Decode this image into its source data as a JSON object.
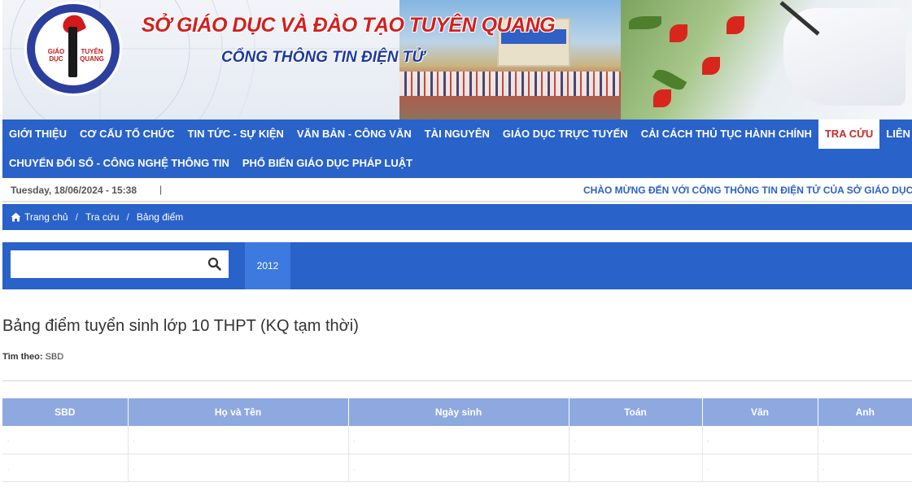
{
  "header": {
    "logo_text_left": "GIÁO DỤC",
    "logo_text_right": "TUYÊN QUANG",
    "title": "SỞ GIÁO DỤC VÀ ĐÀO TẠO TUYÊN QUANG",
    "subtitle": "CỔNG THÔNG TIN ĐIỆN TỬ"
  },
  "menu": {
    "row1": [
      "GIỚI THIỆU",
      "CƠ CẤU TỔ CHỨC",
      "TIN TỨC - SỰ KIỆN",
      "VĂN BẢN - CÔNG VĂN",
      "TÀI NGUYÊN",
      "GIÁO DỤC TRỰC TUYẾN",
      "CẢI CÁCH THỦ TỤC HÀNH CHÍNH",
      "TRA CỨU",
      "LIÊN HỆ"
    ],
    "row2": [
      "CHUYỂN ĐỔI SỐ - CÔNG NGHỆ THÔNG TIN",
      "PHỔ BIẾN GIÁO DỤC PHÁP LUẬT"
    ],
    "active": "TRA CỨU"
  },
  "datebar": {
    "datetime": "Tuesday, 18/06/2024 - 15:38",
    "separator": "|",
    "marquee": "CHÀO MỪNG ĐẾN VỚI CỔNG THÔNG TIN ĐIỆN TỬ CỦA SỞ GIÁO DỤC"
  },
  "breadcrumb": {
    "home": "Trang chủ",
    "items": [
      "Tra cứu",
      "Bảng điểm"
    ],
    "separator": "/"
  },
  "search": {
    "value": "",
    "placeholder": "",
    "year_tab": "2012"
  },
  "content": {
    "title": "Bảng điểm tuyển sinh lớp 10 THPT (KQ tạm thời)",
    "filter_label": "Tìm theo:",
    "filter_value": "SBD"
  },
  "table": {
    "headers": [
      "SBD",
      "Họ và Tên",
      "Ngày sinh",
      "Toán",
      "Văn",
      "Anh"
    ],
    "rows": [
      [
        ".",
        ".",
        ".",
        ".",
        ".",
        "."
      ],
      [
        ".",
        ".",
        ".",
        ".",
        ".",
        "."
      ]
    ]
  },
  "colors": {
    "primary_blue": "#2962c9",
    "active_red": "#c92a2a",
    "table_header": "#8ea9e0"
  }
}
